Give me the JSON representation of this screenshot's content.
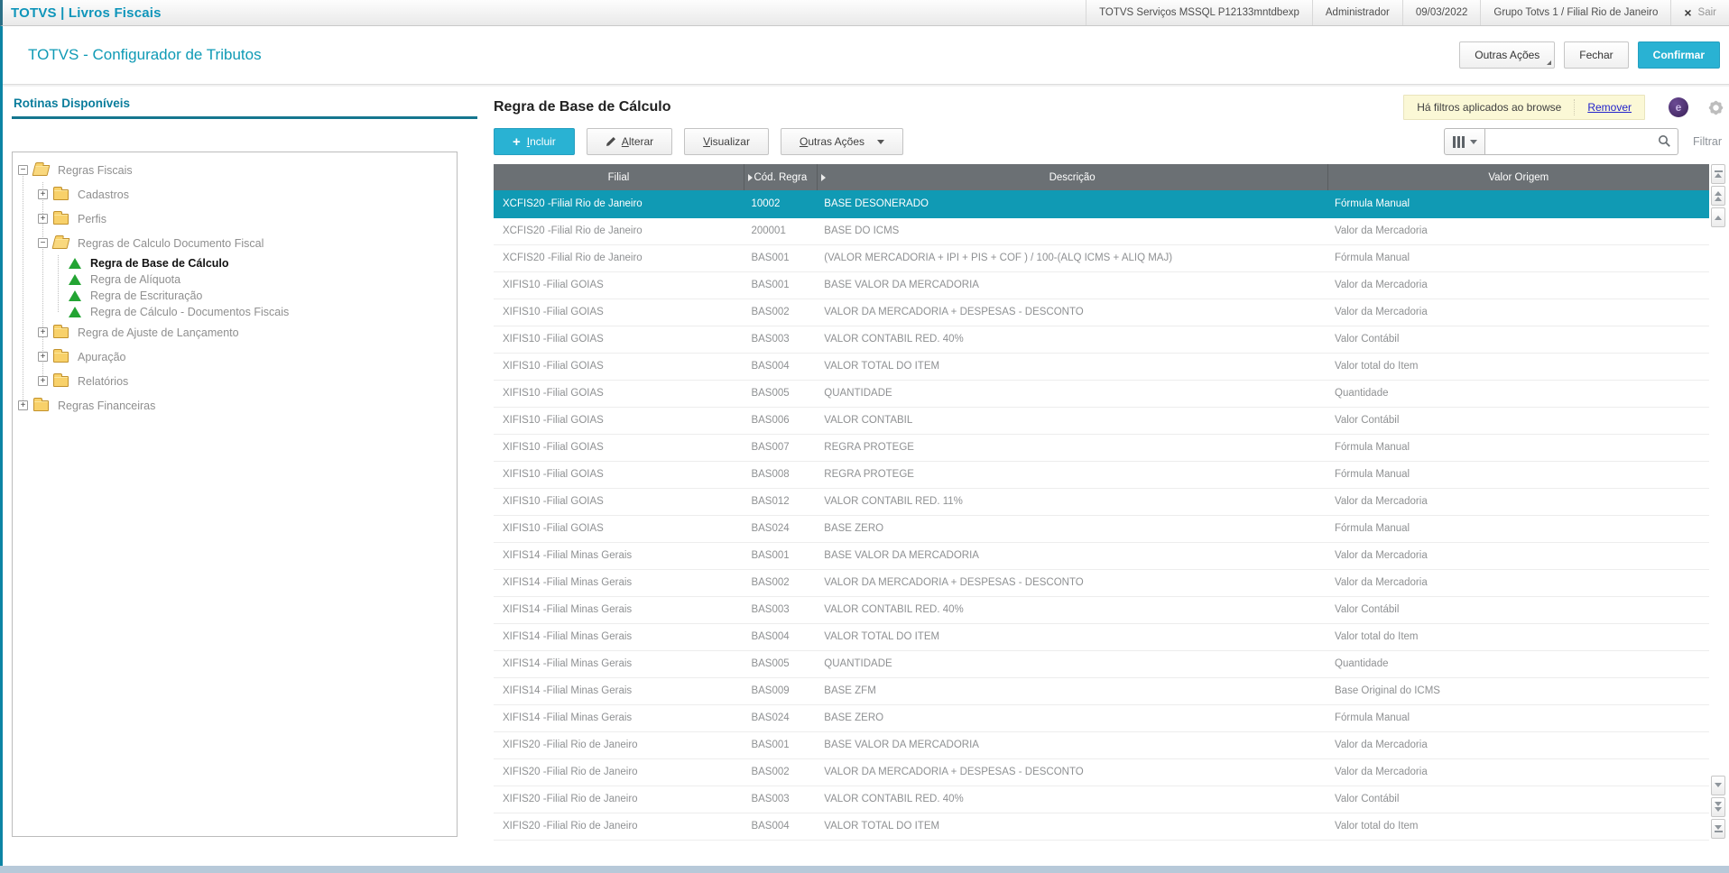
{
  "titlebar": {
    "app_title": "TOTVS | Livros Fiscais",
    "environment": "TOTVS Serviços MSSQL P12133mntdbexp",
    "user": "Administrador",
    "date": "09/03/2022",
    "group_branch": "Grupo Totvs 1 / Filial Rio de Janeiro",
    "close_icon": "×",
    "exit_label": "Sair"
  },
  "window": {
    "title": "TOTVS - Configurador de Tributos",
    "other_actions_label": "Outras Ações",
    "close_label": "Fechar",
    "confirm_label": "Confirmar"
  },
  "sidebar": {
    "title": "Rotinas Disponíveis",
    "tree": [
      {
        "label": "Regras Fiscais",
        "level": 0,
        "icon": "folder-open",
        "expander": "minus"
      },
      {
        "label": "Cadastros",
        "level": 1,
        "icon": "folder",
        "expander": "plus"
      },
      {
        "label": "Perfis",
        "level": 1,
        "icon": "folder",
        "expander": "plus"
      },
      {
        "label": "Regras de Calculo Documento Fiscal",
        "level": 1,
        "icon": "folder-open",
        "expander": "minus"
      },
      {
        "label": "Regra de Base de Cálculo",
        "level": 2,
        "icon": "rule",
        "expander": "none",
        "selected": true
      },
      {
        "label": "Regra de Alíquota",
        "level": 2,
        "icon": "rule",
        "expander": "none"
      },
      {
        "label": "Regra de Escrituração",
        "level": 2,
        "icon": "rule",
        "expander": "none"
      },
      {
        "label": "Regra de Cálculo - Documentos Fiscais",
        "level": 2,
        "icon": "rule",
        "expander": "none"
      },
      {
        "label": "Regra de Ajuste de Lançamento",
        "level": 1,
        "icon": "folder",
        "expander": "plus"
      },
      {
        "label": "Apuração",
        "level": 1,
        "icon": "folder",
        "expander": "plus"
      },
      {
        "label": "Relatórios",
        "level": 1,
        "icon": "folder",
        "expander": "plus"
      },
      {
        "label": "Regras Financeiras",
        "level": 0,
        "icon": "folder",
        "expander": "plus"
      }
    ]
  },
  "browse": {
    "title": "Regra de Base de Cálculo",
    "filter_banner": {
      "text": "Há filtros aplicados ao browse",
      "remove_label": "Remover"
    },
    "toolbar": {
      "include_label": "Incluir",
      "edit_label": "Alterar",
      "view_label": "Visualizar",
      "other_actions_label": "Outras Ações"
    },
    "search": {
      "placeholder": "",
      "filter_label": "Filtrar"
    },
    "table": {
      "columns": [
        "Filial",
        "Cód. Regra",
        "Descrição",
        "Valor Origem"
      ],
      "selected_index": 0,
      "rows": [
        [
          "XCFIS20 -Filial Rio de Janeiro",
          "10002",
          "BASE DESONERADO",
          "Fórmula Manual"
        ],
        [
          "XCFIS20 -Filial Rio de Janeiro",
          "200001",
          "BASE DO ICMS",
          "Valor da Mercadoria"
        ],
        [
          "XCFIS20 -Filial Rio de Janeiro",
          "BAS001",
          "(VALOR MERCADORIA + IPI + PIS + COF ) / 100-(ALQ ICMS + ALIQ MAJ)",
          "Fórmula Manual"
        ],
        [
          "XIFIS10 -Filial GOIAS",
          "BAS001",
          "BASE VALOR DA MERCADORIA",
          "Valor da Mercadoria"
        ],
        [
          "XIFIS10 -Filial GOIAS",
          "BAS002",
          "VALOR DA MERCADORIA + DESPESAS - DESCONTO",
          "Valor da Mercadoria"
        ],
        [
          "XIFIS10 -Filial GOIAS",
          "BAS003",
          "VALOR CONTABIL RED. 40%",
          "Valor Contábil"
        ],
        [
          "XIFIS10 -Filial GOIAS",
          "BAS004",
          "VALOR TOTAL DO ITEM",
          "Valor total do Item"
        ],
        [
          "XIFIS10 -Filial GOIAS",
          "BAS005",
          "QUANTIDADE",
          "Quantidade"
        ],
        [
          "XIFIS10 -Filial GOIAS",
          "BAS006",
          "VALOR CONTABIL",
          "Valor Contábil"
        ],
        [
          "XIFIS10 -Filial GOIAS",
          "BAS007",
          "REGRA PROTEGE",
          "Fórmula Manual"
        ],
        [
          "XIFIS10 -Filial GOIAS",
          "BAS008",
          "REGRA PROTEGE",
          "Fórmula Manual"
        ],
        [
          "XIFIS10 -Filial GOIAS",
          "BAS012",
          "VALOR CONTABIL RED. 11%",
          "Valor da Mercadoria"
        ],
        [
          "XIFIS10 -Filial GOIAS",
          "BAS024",
          "BASE ZERO",
          "Fórmula Manual"
        ],
        [
          "XIFIS14 -Filial Minas Gerais",
          "BAS001",
          "BASE VALOR DA MERCADORIA",
          "Valor da Mercadoria"
        ],
        [
          "XIFIS14 -Filial Minas Gerais",
          "BAS002",
          "VALOR DA MERCADORIA + DESPESAS - DESCONTO",
          "Valor da Mercadoria"
        ],
        [
          "XIFIS14 -Filial Minas Gerais",
          "BAS003",
          "VALOR CONTABIL RED. 40%",
          "Valor Contábil"
        ],
        [
          "XIFIS14 -Filial Minas Gerais",
          "BAS004",
          "VALOR TOTAL DO ITEM",
          "Valor total do Item"
        ],
        [
          "XIFIS14 -Filial Minas Gerais",
          "BAS005",
          "QUANTIDADE",
          "Quantidade"
        ],
        [
          "XIFIS14 -Filial Minas Gerais",
          "BAS009",
          "BASE ZFM",
          "Base Original do ICMS"
        ],
        [
          "XIFIS14 -Filial Minas Gerais",
          "BAS024",
          "BASE ZERO",
          "Fórmula Manual"
        ],
        [
          "XIFIS20 -Filial Rio de Janeiro",
          "BAS001",
          "BASE VALOR DA MERCADORIA",
          "Valor da Mercadoria"
        ],
        [
          "XIFIS20 -Filial Rio de Janeiro",
          "BAS002",
          "VALOR DA MERCADORIA + DESPESAS - DESCONTO",
          "Valor da Mercadoria"
        ],
        [
          "XIFIS20 -Filial Rio de Janeiro",
          "BAS003",
          "VALOR CONTABIL RED. 40%",
          "Valor Contábil"
        ],
        [
          "XIFIS20 -Filial Rio de Janeiro",
          "BAS004",
          "VALOR TOTAL DO ITEM",
          "Valor total do Item"
        ]
      ]
    }
  },
  "icons": {
    "toolbar_include": "plus-icon",
    "toolbar_edit": "pencil-icon",
    "dropdowns": "caret-down-icon",
    "search": "magnifier-icon",
    "columns": "columns-icon",
    "settings": "gear-icon",
    "assistant": "avatar-icon",
    "exit": "x-icon",
    "tree_folder": "folder-icon",
    "tree_rule": "green-triangle-icon",
    "scrollbar": [
      "scroll-top-icon",
      "page-up-icon",
      "step-up-icon",
      "step-down-icon",
      "page-down-icon",
      "scroll-bottom-icon"
    ]
  },
  "colors": {
    "accent_teal": "#0f95ba",
    "button_teal": "#29b2d3",
    "selected_row": "#109ab4",
    "header_gray": "#6b7074",
    "banner_yellow": "#fbf8d6",
    "folder_yellow": "#f8d16a",
    "rule_green": "#23a433",
    "footer_strip": "#b7c9d9"
  }
}
